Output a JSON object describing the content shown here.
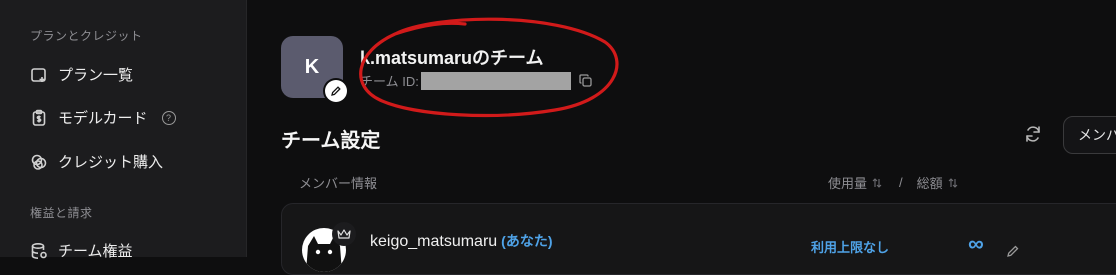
{
  "sidebar": {
    "section1_title": "プランとクレジット",
    "section1_items": [
      {
        "label": "プラン一覧",
        "icon": "plan-add-icon"
      },
      {
        "label": "モデルカード",
        "icon": "clipboard-dollar-icon",
        "help": "?"
      },
      {
        "label": "クレジット購入",
        "icon": "coins-icon"
      }
    ],
    "section2_title": "権益と請求",
    "section2_items": [
      {
        "label": "チーム権益",
        "icon": "database-icon"
      }
    ]
  },
  "team": {
    "avatar_letter": "K",
    "name": "k.matsumaruのチーム",
    "id_label": "チーム ID:"
  },
  "page": {
    "title": "チーム設定",
    "member_button": "メンバ"
  },
  "table": {
    "col_member_info": "メンバー情報",
    "col_usage": "使用量",
    "col_sep": "/",
    "col_total": "総額",
    "rows": [
      {
        "name": "keigo_matsumaru",
        "you": "(あなた)",
        "limit": "利用上限なし",
        "total": "∞"
      }
    ]
  },
  "colors": {
    "accent": "#4fa3e8",
    "annotation": "#d11a1a",
    "sidebar_bg": "#1c1c1e",
    "main_bg": "#0e0e0f"
  }
}
